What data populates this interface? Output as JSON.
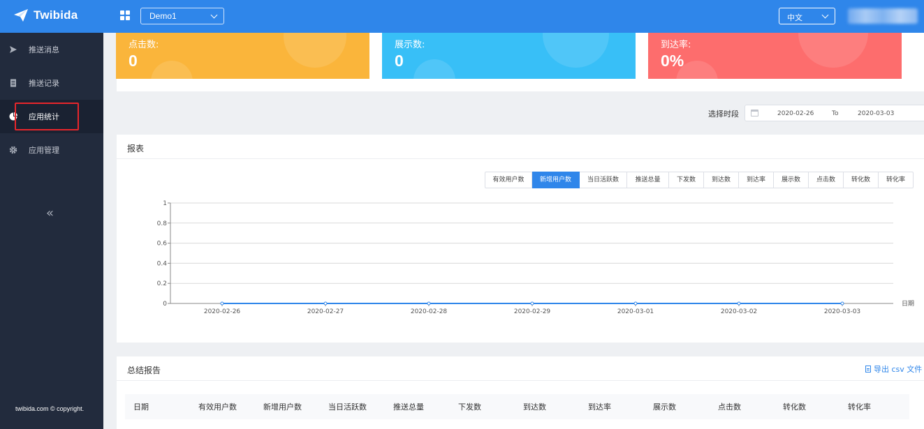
{
  "header": {
    "brand": "Twibida",
    "app_select": "Demo1",
    "language": "中文"
  },
  "sidebar": {
    "items": [
      {
        "label": "推送消息",
        "icon": "send-icon"
      },
      {
        "label": "推送记录",
        "icon": "document-icon"
      },
      {
        "label": "应用统计",
        "icon": "pie-chart-icon",
        "active": true
      },
      {
        "label": "应用管理",
        "icon": "gear-icon"
      }
    ],
    "collapse": "«",
    "copyright": "twibida.com © copyright."
  },
  "stats": [
    {
      "label": "点击数:",
      "value": "0",
      "color": "#fab53b"
    },
    {
      "label": "展示数:",
      "value": "0",
      "color": "#38bff7"
    },
    {
      "label": "到达率:",
      "value": "0%",
      "color": "#fd6d6d"
    }
  ],
  "period": {
    "label": "选择时段",
    "start": "2020-02-26",
    "to": "To",
    "end": "2020-03-03"
  },
  "report": {
    "title": "报表",
    "tabs": [
      "有效用户数",
      "新增用户数",
      "当日活跃数",
      "推送总量",
      "下发数",
      "到达数",
      "到达率",
      "展示数",
      "点击数",
      "转化数",
      "转化率"
    ],
    "active_tab": 1
  },
  "chart_data": {
    "type": "line",
    "x": [
      "2020-02-26",
      "2020-02-27",
      "2020-02-28",
      "2020-02-29",
      "2020-03-01",
      "2020-03-02",
      "2020-03-03"
    ],
    "series": [
      {
        "values": [
          0,
          0,
          0,
          0,
          0,
          0,
          0
        ],
        "color": "#2f86ea"
      }
    ],
    "y_ticks": [
      "1",
      "0.8",
      "0.6",
      "0.4",
      "0.2",
      "0"
    ],
    "ylim": [
      0,
      1
    ],
    "xlabel": "日期",
    "grid": true
  },
  "summary": {
    "title": "总结报告",
    "export": "导出 csv 文件",
    "columns": [
      "日期",
      "有效用户数",
      "新增用户数",
      "当日活跃数",
      "推送总量",
      "下发数",
      "到达数",
      "到达率",
      "展示数",
      "点击数",
      "转化数",
      "转化率"
    ]
  }
}
